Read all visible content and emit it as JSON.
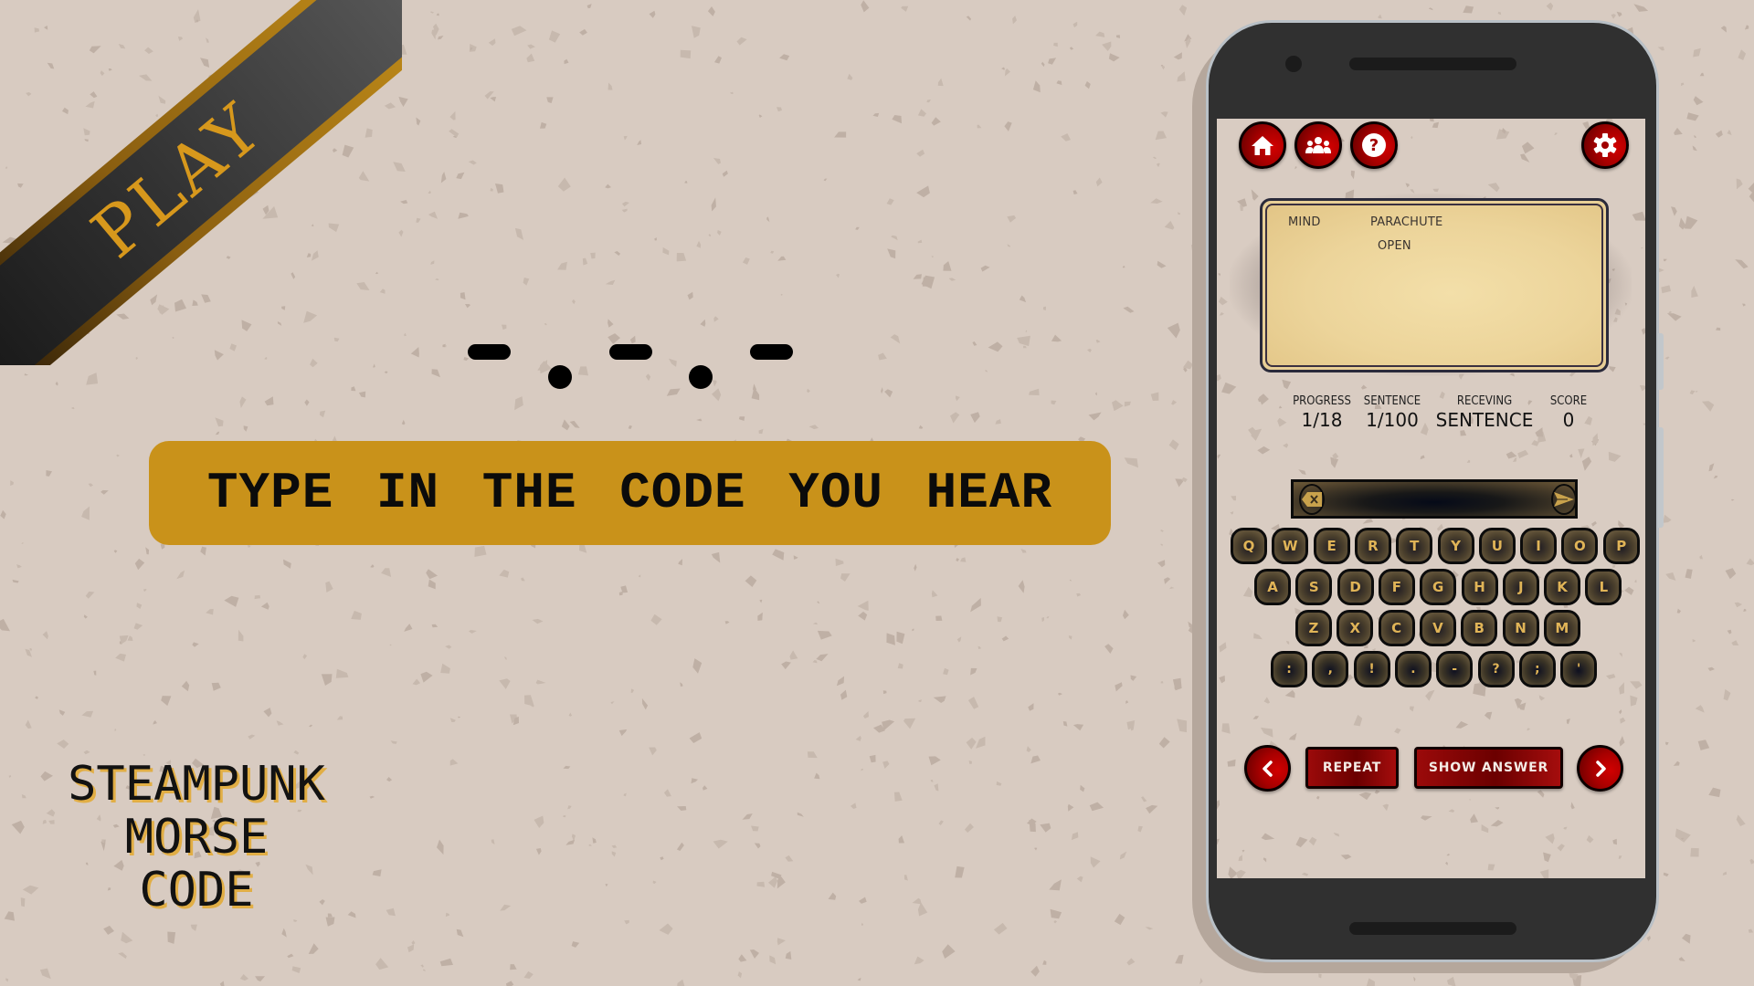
{
  "ribbon": {
    "label": "PLAY"
  },
  "morse": {
    "pattern": [
      "dash",
      "dot",
      "dash",
      "dot",
      "dash"
    ]
  },
  "instruction": {
    "text": "TYPE IN THE CODE YOU HEAR"
  },
  "app_title": {
    "lines": [
      "STEAMPUNK",
      "MORSE",
      "CODE"
    ]
  },
  "colors": {
    "background": "#d8cbc1",
    "accent_gold": "#c9921a",
    "button_red": "#a80000",
    "key_text": "#e0b457",
    "phone_body": "#303030"
  },
  "phone": {
    "top_nav": [
      {
        "icon": "home-icon",
        "label": "Home"
      },
      {
        "icon": "users-icon",
        "label": "Multiplayer"
      },
      {
        "icon": "help-icon",
        "label": "Help"
      }
    ],
    "settings": {
      "icon": "gear-icon",
      "label": "Settings"
    },
    "card": {
      "words": [
        {
          "text": "MIND"
        },
        {
          "text": "PARACHUTE"
        },
        {
          "text": "OPEN"
        }
      ]
    },
    "stats": [
      {
        "label": "PROGRESS",
        "value": "1/18"
      },
      {
        "label": "SENTENCE",
        "value": "1/100"
      },
      {
        "label": "RECEVING",
        "value": "SENTENCE"
      },
      {
        "label": "SCORE",
        "value": "0"
      }
    ],
    "input": {
      "value": "",
      "placeholder": "",
      "clear_icon": "backspace-icon",
      "send_icon": "send-icon"
    },
    "keyboard": {
      "rows": [
        [
          "Q",
          "W",
          "E",
          "R",
          "T",
          "Y",
          "U",
          "I",
          "O",
          "P"
        ],
        [
          "A",
          "S",
          "D",
          "F",
          "G",
          "H",
          "J",
          "K",
          "L"
        ],
        [
          "Z",
          "X",
          "C",
          "V",
          "B",
          "N",
          "M"
        ],
        [
          ":",
          ",",
          "!",
          ".",
          "-",
          "?",
          ";",
          "'"
        ]
      ]
    },
    "controls": {
      "prev_icon": "chevron-left-icon",
      "repeat_label": "REPEAT",
      "show_answer_label": "SHOW ANSWER",
      "next_icon": "chevron-right-icon"
    }
  }
}
